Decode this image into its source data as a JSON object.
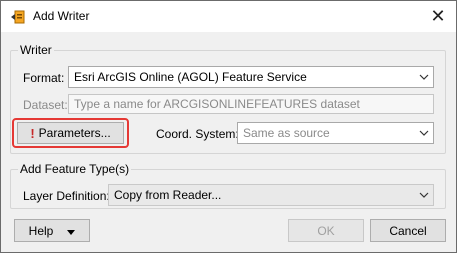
{
  "window": {
    "title": "Add Writer",
    "close_glyph": "✕"
  },
  "writer_group": {
    "title": "Writer",
    "format_label": "Format:",
    "format_value": "Esri ArcGIS Online (AGOL) Feature Service",
    "dataset_label": "Dataset:",
    "dataset_placeholder": "Type a name for ARCGISONLINEFEATURES dataset",
    "parameters_button": "Parameters...",
    "parameters_warning_glyph": "!",
    "coord_label": "Coord. System:",
    "coord_placeholder": "Same as source"
  },
  "feature_type_group": {
    "title": "Add Feature Type(s)",
    "layer_definition_label": "Layer Definition:",
    "layer_definition_value": "Copy from Reader..."
  },
  "footer": {
    "help_label": "Help",
    "ok_label": "OK",
    "cancel_label": "Cancel"
  },
  "colors": {
    "highlight": "#e53935",
    "warning": "#c62828"
  }
}
